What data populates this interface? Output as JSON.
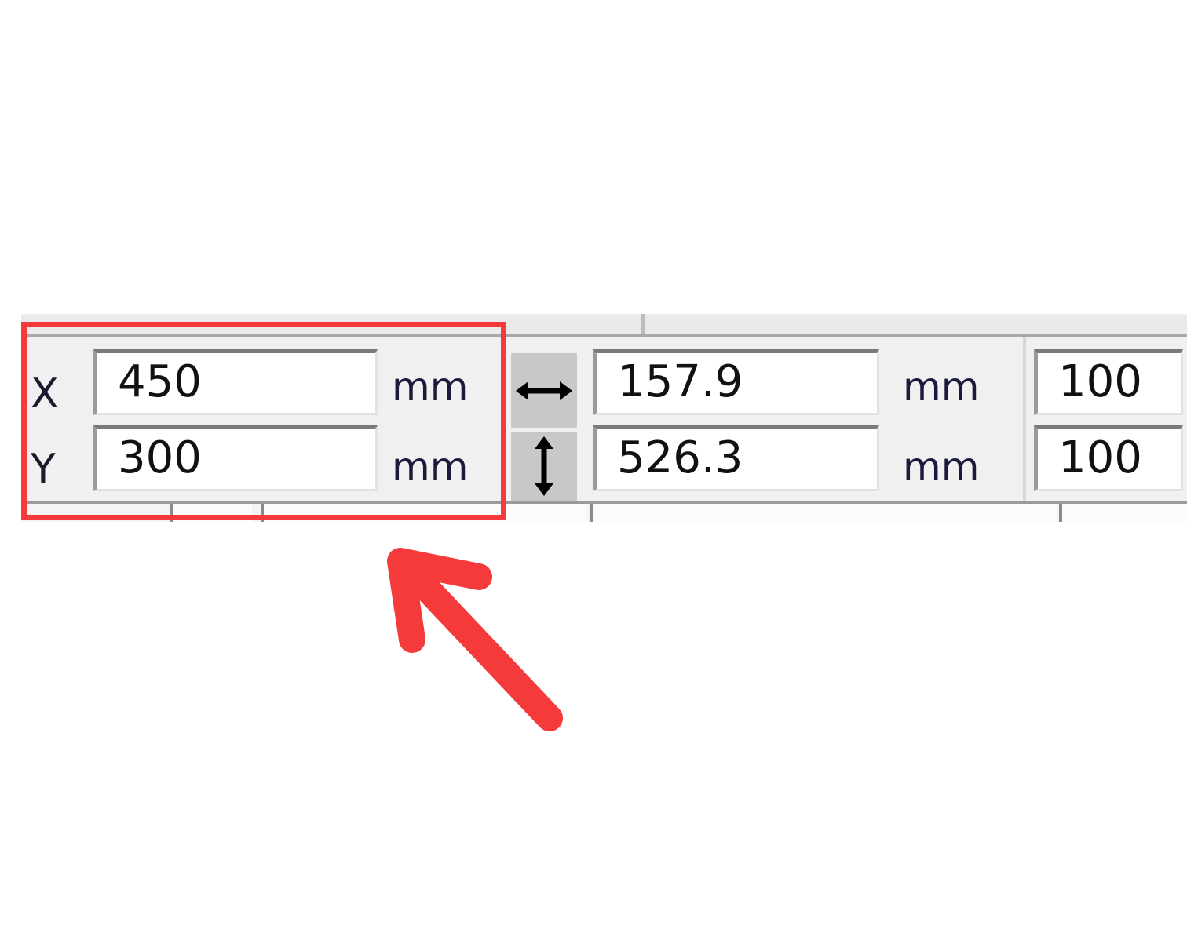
{
  "position": {
    "x": {
      "axis_label": "X",
      "value": "450",
      "unit": "mm"
    },
    "y": {
      "axis_label": "Y",
      "value": "300",
      "unit": "mm"
    }
  },
  "size": {
    "width": {
      "icon": "horizontal-double-arrow-icon",
      "value": "157.9",
      "unit": "mm"
    },
    "height": {
      "icon": "vertical-double-arrow-icon",
      "value": "526.3",
      "unit": "mm"
    }
  },
  "scale": {
    "width_percent": "100",
    "height_percent": "100"
  },
  "annotation": {
    "highlight_color": "#f43a3a",
    "arrow_icon": "red-arrow-pointing-up-left-icon"
  }
}
